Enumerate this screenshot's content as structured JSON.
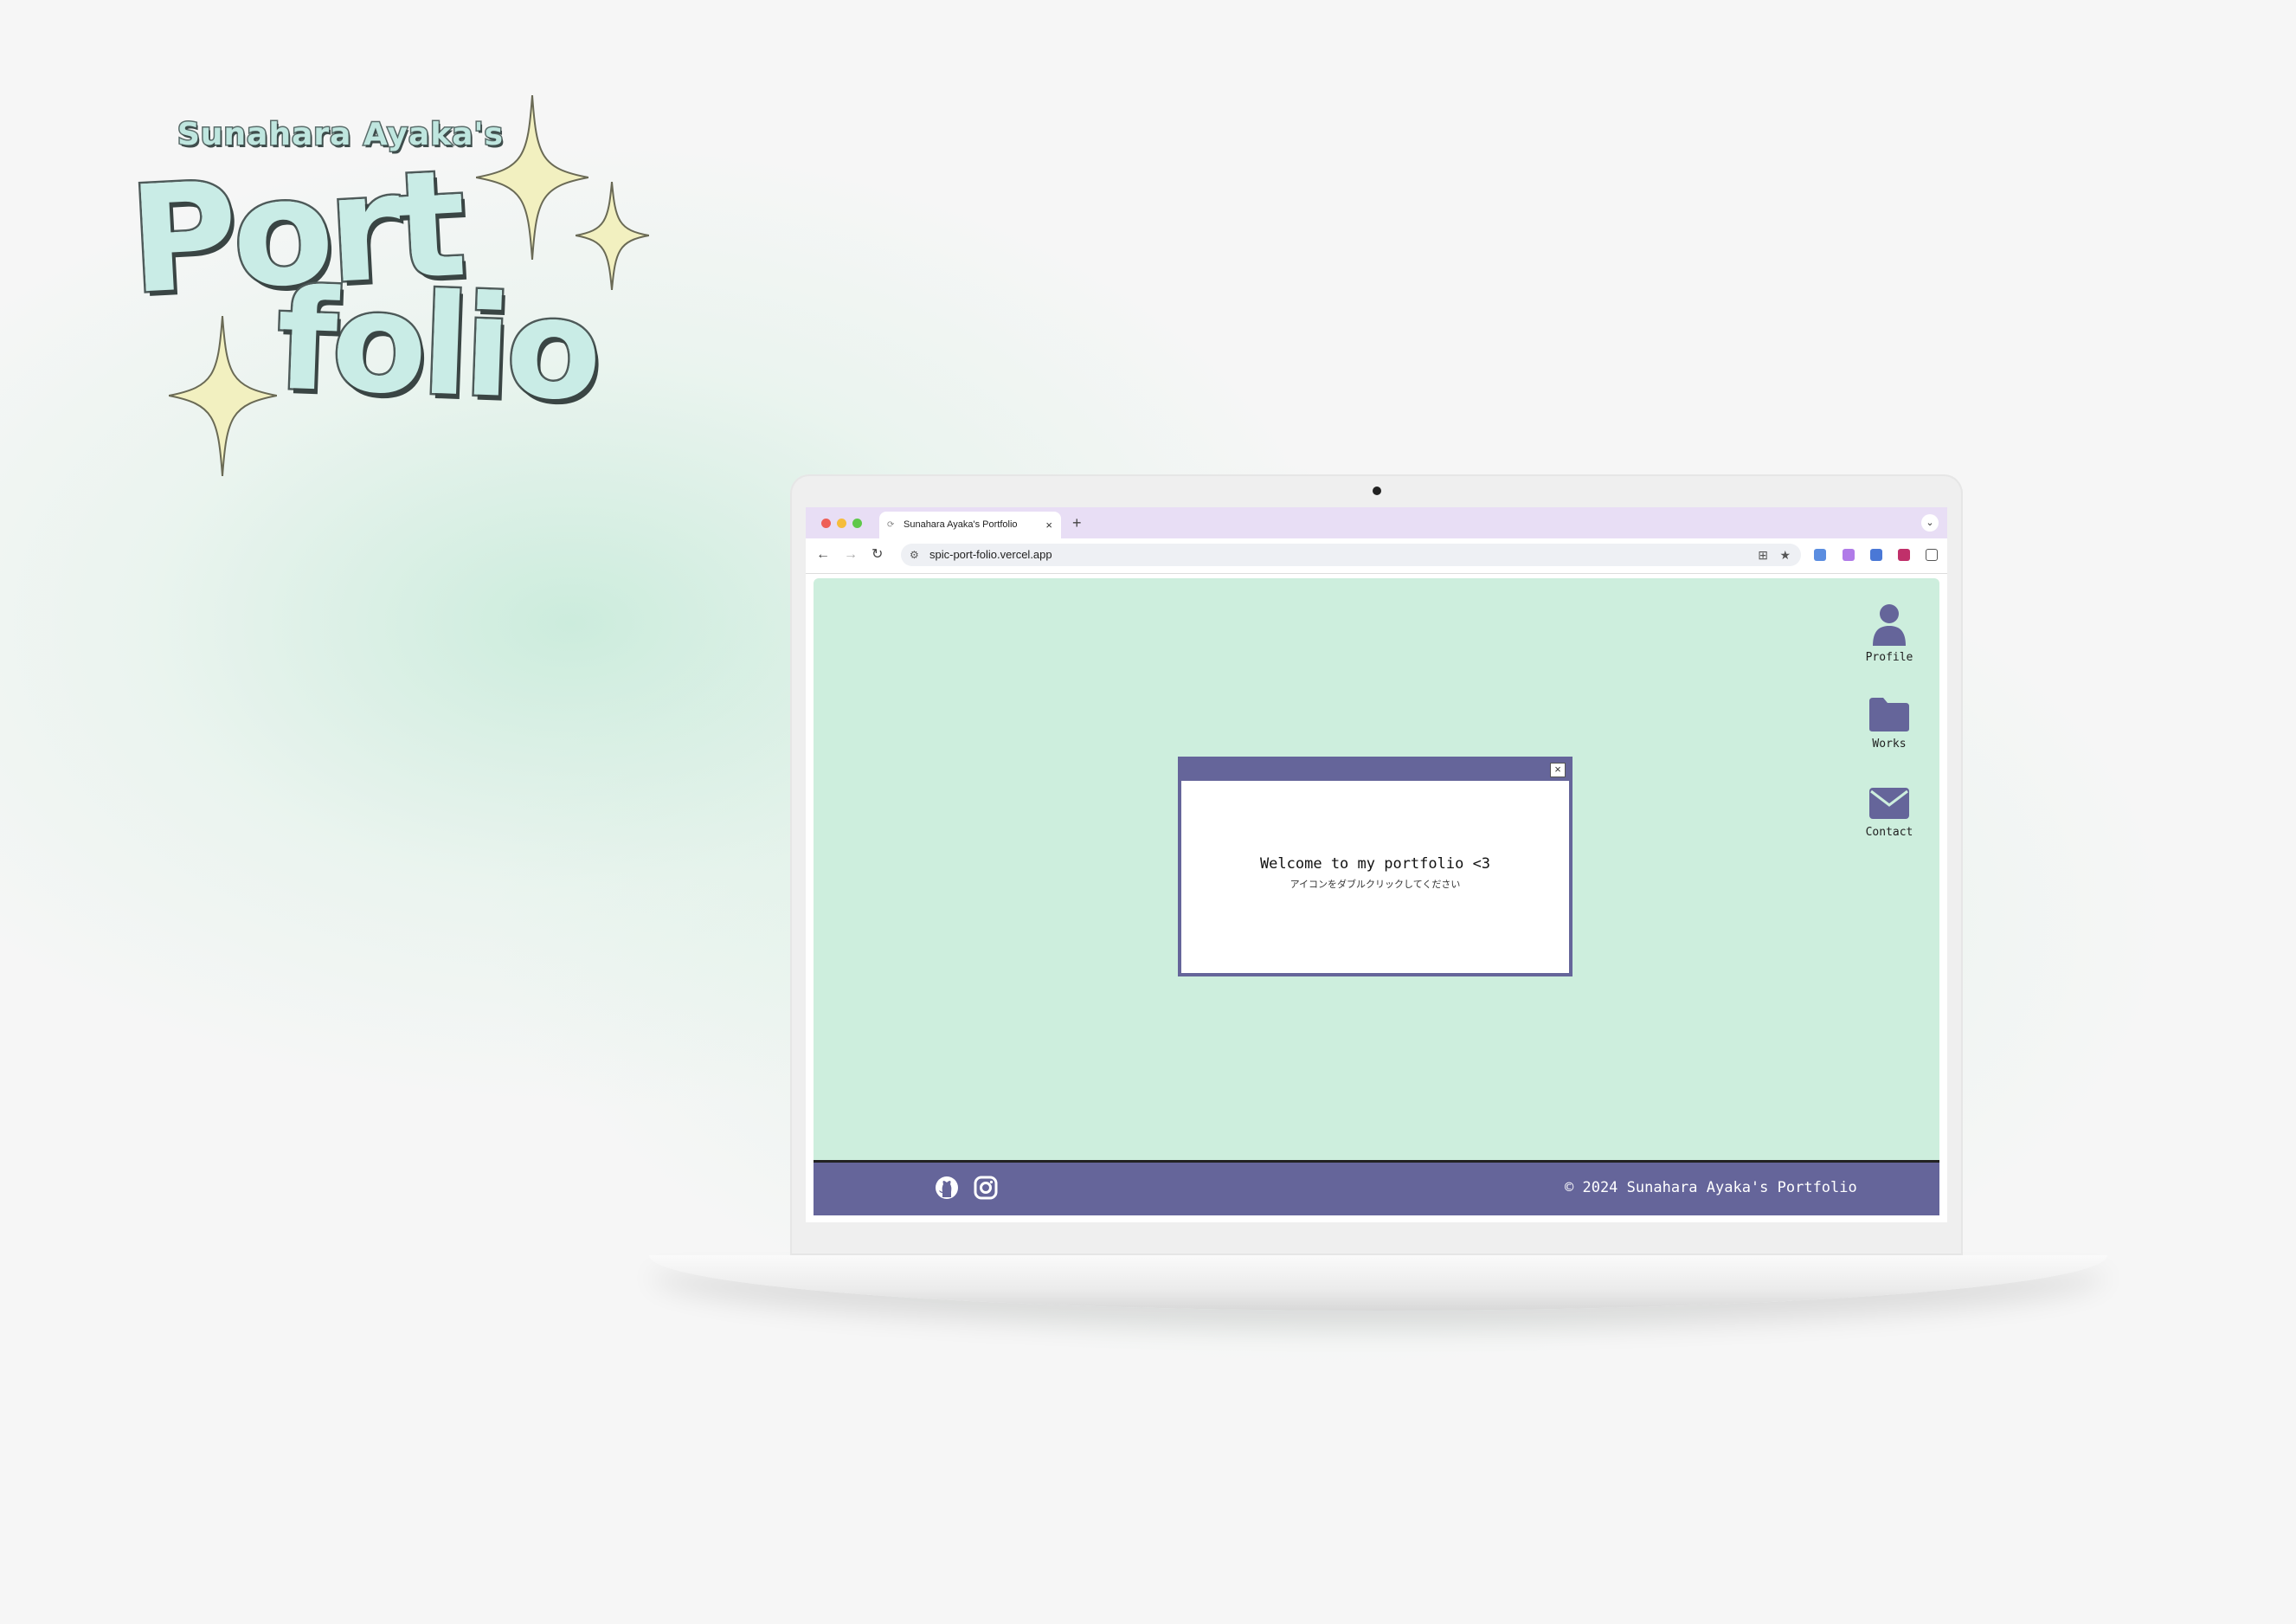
{
  "logo": {
    "subtitle": "Sunahara Ayaka's",
    "word_1": "Port",
    "word_2": "folio"
  },
  "browser": {
    "tab_title": "Sunahara Ayaka's Portfolio",
    "tab_close": "×",
    "new_tab": "+",
    "tab_menu": "⌄",
    "back": "←",
    "forward": "→",
    "reload": "↻",
    "url": "spic-port-folio.vercel.app",
    "menu": "⋮"
  },
  "desktop": {
    "icons": [
      {
        "label": "Profile",
        "icon": "person-icon"
      },
      {
        "label": "Works",
        "icon": "folder-icon"
      },
      {
        "label": "Contact",
        "icon": "mail-icon"
      }
    ]
  },
  "welcome_window": {
    "close": "×",
    "message": "Welcome to my portfolio <3",
    "sub_message": "アイコンをダブルクリックしてください"
  },
  "footer": {
    "social_icons": [
      "github-icon",
      "instagram-icon"
    ],
    "copyright": "© 2024 Sunahara Ayaka's Portfolio"
  },
  "colors": {
    "desktop_bg": "#cdeedd",
    "accent": "#65659a",
    "tabbar": "#e8def5",
    "logo_fill": "#c9ece6",
    "sparkle": "#f2f0c0"
  }
}
